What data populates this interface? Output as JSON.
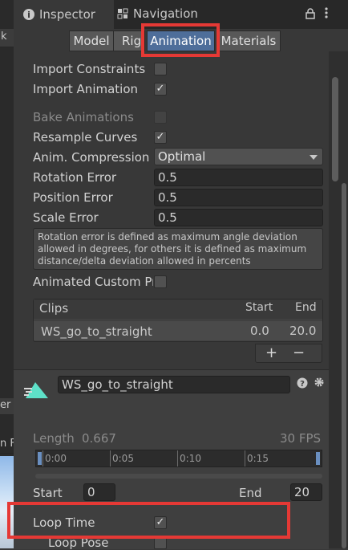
{
  "left_panel": {
    "peek_labels": [
      "k",
      "er",
      "n F"
    ]
  },
  "tabs": {
    "inspector_label": "Inspector",
    "navigation_label": "Navigation"
  },
  "mode_buttons": {
    "model": "Model",
    "rig": "Rig",
    "animation": "Animation",
    "materials": "Materials",
    "active": "Animation"
  },
  "settings": {
    "import_constraints": {
      "label": "Import Constraints",
      "checked": false
    },
    "import_animation": {
      "label": "Import Animation",
      "checked": true
    },
    "bake_animations": {
      "label": "Bake Animations",
      "checked": false
    },
    "resample_curves": {
      "label": "Resample Curves",
      "checked": true
    },
    "anim_compression": {
      "label": "Anim. Compression",
      "value": "Optimal"
    },
    "rotation_error": {
      "label": "Rotation Error",
      "value": "0.5"
    },
    "position_error": {
      "label": "Position Error",
      "value": "0.5"
    },
    "scale_error": {
      "label": "Scale Error",
      "value": "0.5"
    },
    "help_text": "Rotation error is defined as maximum angle deviation allowed in degrees, for others it is defined as maximum distance/delta deviation allowed in percents",
    "animated_custom_props": {
      "label": "Animated Custom Pro",
      "checked": false
    }
  },
  "clips": {
    "headers": {
      "clips": "Clips",
      "start": "Start",
      "end": "End"
    },
    "rows": [
      {
        "name": "WS_go_to_straight",
        "start": "0.0",
        "end": "20.0"
      }
    ],
    "add": "+",
    "remove": "−"
  },
  "clip_detail": {
    "name": "WS_go_to_straight",
    "length_label": "Length",
    "length_value": "0.667",
    "fps": "30 FPS",
    "timeline_ticks": [
      "0:00",
      "0:05",
      "0:10",
      "0:15"
    ],
    "start_label": "Start",
    "start_value": "0",
    "end_label": "End",
    "end_value": "20",
    "loop_time": {
      "label": "Loop Time",
      "checked": true
    },
    "loop_pose": {
      "label": "Loop Pose",
      "checked": false
    }
  },
  "colors": {
    "highlight": "#e53935",
    "active_tab": "#4e6e9a",
    "clip_icon": "#5ee0c8"
  }
}
